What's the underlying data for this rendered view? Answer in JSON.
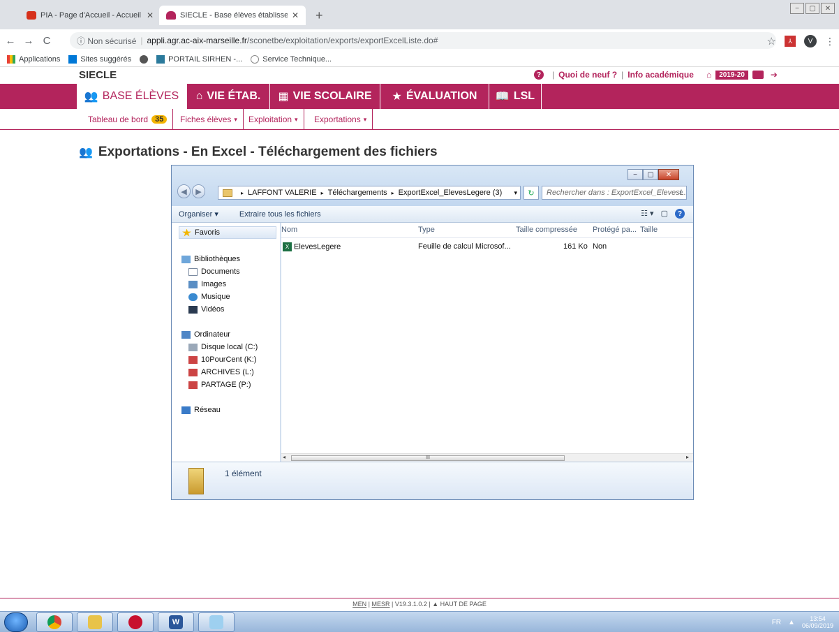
{
  "browser": {
    "tabs": [
      {
        "title": "PIA - Page d'Accueil - Accueil Epl",
        "close": "✕"
      },
      {
        "title": "SIECLE - Base élèves établisseme",
        "close": "✕"
      }
    ],
    "newtab": "+",
    "window_controls": [
      "−",
      "▢",
      "✕"
    ],
    "nav": {
      "back": "←",
      "forward": "→",
      "reload": "C"
    },
    "address": {
      "security": "ⓘ Non sécurisé",
      "host": "appli.agr.ac-aix-marseille.fr",
      "path": "/sconetbe/exploitation/exports/exportExcelListe.do#"
    },
    "star": "☆",
    "pdf_label": "⅄",
    "avatar": "V",
    "menu": "⋮",
    "bookmarks": [
      {
        "label": "Applications",
        "color": "#e94235"
      },
      {
        "label": "Sites suggérés",
        "color": "#0078d7"
      },
      {
        "label": "",
        "color": "#555"
      },
      {
        "label": "PORTAIL SIRHEN -...",
        "color": "#2b7a9c"
      },
      {
        "label": "Service Technique...",
        "color": "#888"
      }
    ]
  },
  "siecle": {
    "title": "SIECLE",
    "help": "?",
    "whats_new": "Quoi de neuf ?",
    "info": "Info académique",
    "sep": "|",
    "year": "2019-20",
    "bank_icon": "⌂",
    "exit_icon": "➔",
    "main_nav": [
      {
        "icon": "👥",
        "label": "BASE ÉLÈVES",
        "active": true
      },
      {
        "icon": "⌂",
        "label": "VIE ÉTAB."
      },
      {
        "icon": "▦",
        "label": "VIE SCOLAIRE"
      },
      {
        "icon": "★",
        "label": "ÉVALUATION"
      },
      {
        "icon": "📖",
        "label": "LSL"
      }
    ],
    "sub_nav": [
      {
        "label": "Tableau de bord",
        "badge": "35"
      },
      {
        "label": "Fiches élèves",
        "caret": "▾"
      },
      {
        "label": "Exploitation",
        "caret": "▾"
      },
      {
        "label": "Exportations",
        "caret": "▾"
      }
    ],
    "page_icon": "👥",
    "page_title": "Exportations - En Excel - Téléchargement des fichiers"
  },
  "explorer": {
    "wctl": [
      "−",
      "▢",
      "✕"
    ],
    "back": "◀",
    "forward": "▶",
    "path": [
      "LAFFONT VALERIE",
      "Téléchargements",
      "ExportExcel_ElevesLegere (3)"
    ],
    "path_arrow": "▸",
    "dropdown": "▾",
    "refresh": "↻",
    "search_placeholder": "Rechercher dans : ExportExcel_ElevesL...",
    "search_icon": "⌕",
    "toolbar": {
      "organize": "Organiser ▾",
      "extract": "Extraire tous les fichiers",
      "view": "☷ ▾",
      "pane": "▢",
      "help": "?"
    },
    "tree": {
      "favoris": "Favoris",
      "bibliotheques": "Bibliothèques",
      "documents": "Documents",
      "images": "Images",
      "musique": "Musique",
      "videos": "Vidéos",
      "ordinateur": "Ordinateur",
      "disque": "Disque local (C:)",
      "k": "10PourCent (K:)",
      "l": "ARCHIVES (L:)",
      "p": "PARTAGE (P:)",
      "reseau": "Réseau"
    },
    "columns": [
      "Nom",
      "Type",
      "Taille compressée",
      "Protégé pa...",
      "Taille"
    ],
    "files": [
      {
        "name": "ElevesLegere",
        "type": "Feuille de calcul Microsof...",
        "size": "161 Ko",
        "protected": "Non"
      }
    ],
    "xls_glyph": "X",
    "scroll": {
      "left": "◂",
      "right": "▸",
      "grip": "III"
    },
    "status": "1 élément"
  },
  "footer": {
    "men": "MEN",
    "mesr": "MESR",
    "version": "| V19.3.1.0.2 |",
    "top": "▲ HAUT DE PAGE"
  },
  "taskbar": {
    "lang": "FR",
    "tray_arrow": "▲",
    "time": "13:54",
    "date": "06/09/2019",
    "apps": [
      {
        "name": "chrome",
        "color": "#db4437"
      },
      {
        "name": "explorer",
        "color": "#e8c34a"
      },
      {
        "name": "app-c",
        "color": "#c8102e"
      },
      {
        "name": "word",
        "color": "#2b579a"
      },
      {
        "name": "notepad",
        "color": "#5aa0d8"
      }
    ],
    "word_glyph": "W"
  }
}
